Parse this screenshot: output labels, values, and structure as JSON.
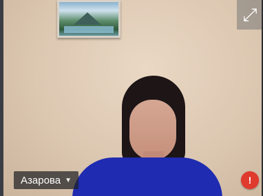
{
  "participant": {
    "name": "Азарова",
    "menu_icon": "chevron-down-icon",
    "tile_icon": "fullscreen-icon",
    "status_icon": "red-badge-icon"
  }
}
